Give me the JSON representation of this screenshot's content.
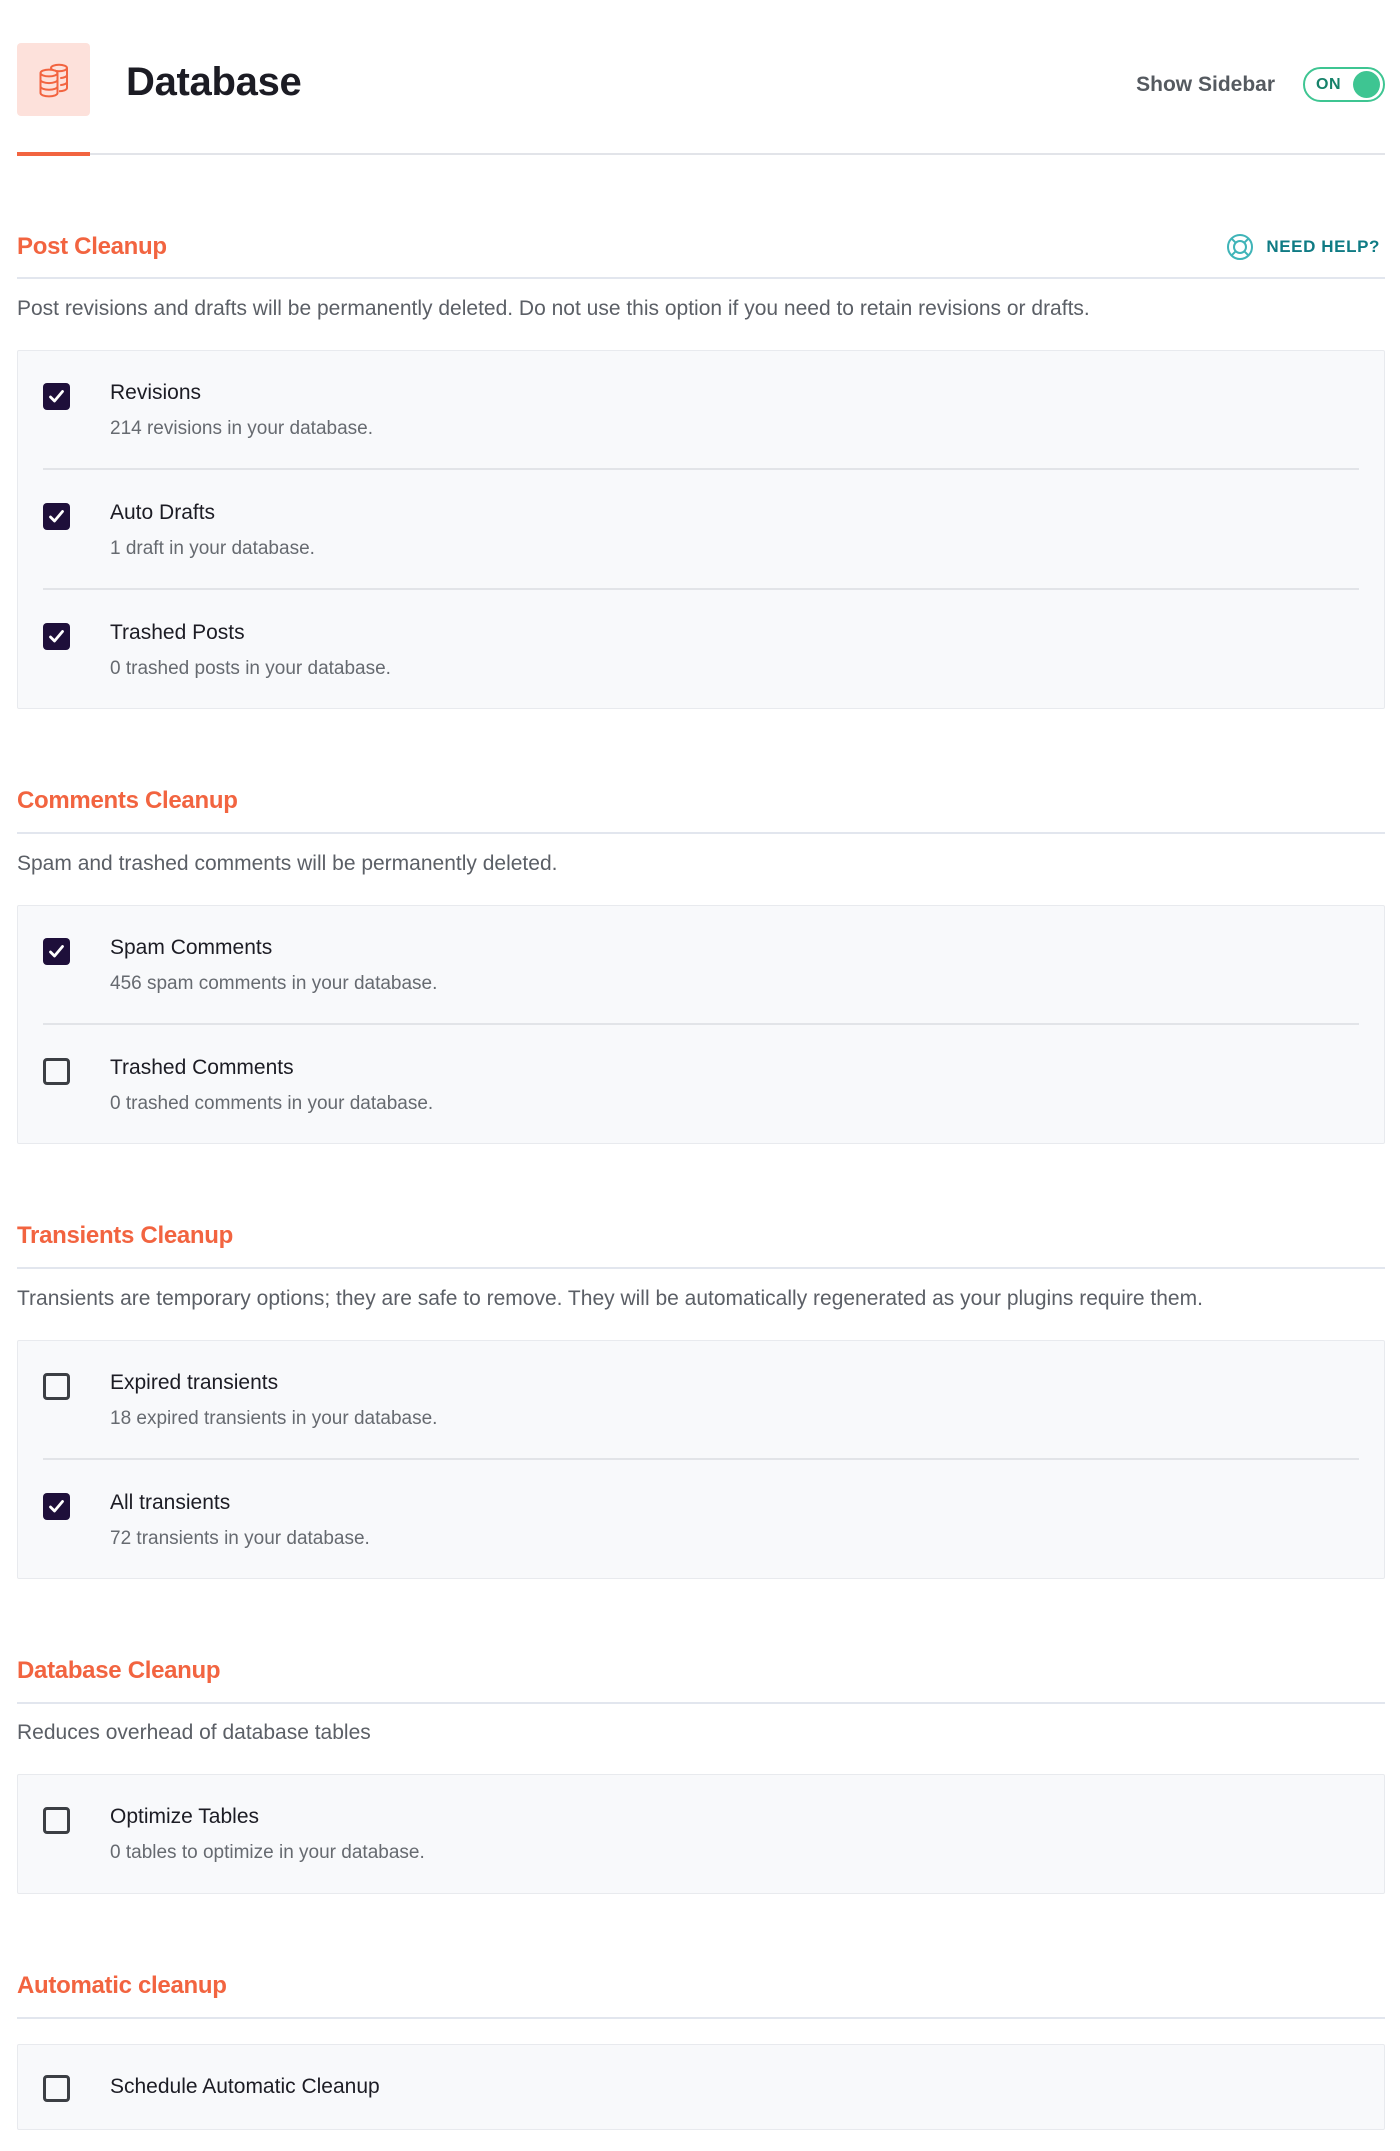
{
  "header": {
    "title": "Database",
    "icon": "database-icon",
    "show_sidebar_label": "Show Sidebar",
    "show_sidebar_state": "ON",
    "show_sidebar_on": true
  },
  "colors": {
    "accent": "#f26440",
    "accent_bg": "#fde1db",
    "toggle_green": "#3ec592",
    "help_teal": "#0f7b84",
    "checkbox_checked": "#1e0f3a"
  },
  "help": {
    "label": "NEED HELP?",
    "icon": "life-ring-icon"
  },
  "sections": [
    {
      "title": "Post Cleanup",
      "description": "Post revisions and drafts will be permanently deleted. Do not use this option if you need to retain revisions or drafts.",
      "items": [
        {
          "label": "Revisions",
          "detail": "214 revisions in your database.",
          "checked": true
        },
        {
          "label": "Auto Drafts",
          "detail": "1 draft in your database.",
          "checked": true
        },
        {
          "label": "Trashed Posts",
          "detail": "0 trashed posts in your database.",
          "checked": true
        }
      ]
    },
    {
      "title": "Comments Cleanup",
      "description": "Spam and trashed comments will be permanently deleted.",
      "items": [
        {
          "label": "Spam Comments",
          "detail": "456 spam comments in your database.",
          "checked": true
        },
        {
          "label": "Trashed Comments",
          "detail": "0 trashed comments in your database.",
          "checked": false
        }
      ]
    },
    {
      "title": "Transients Cleanup",
      "description": "Transients are temporary options; they are safe to remove. They will be automatically regenerated as your plugins require them.",
      "items": [
        {
          "label": "Expired transients",
          "detail": "18 expired transients in your database.",
          "checked": false
        },
        {
          "label": "All transients",
          "detail": "72 transients in your database.",
          "checked": true
        }
      ]
    },
    {
      "title": "Database Cleanup",
      "description": "Reduces overhead of database tables",
      "items": [
        {
          "label": "Optimize Tables",
          "detail": "0 tables to optimize in your database.",
          "checked": false
        }
      ]
    },
    {
      "title": "Automatic cleanup",
      "items": [
        {
          "label": "Schedule Automatic Cleanup",
          "checked": false
        }
      ]
    }
  ]
}
